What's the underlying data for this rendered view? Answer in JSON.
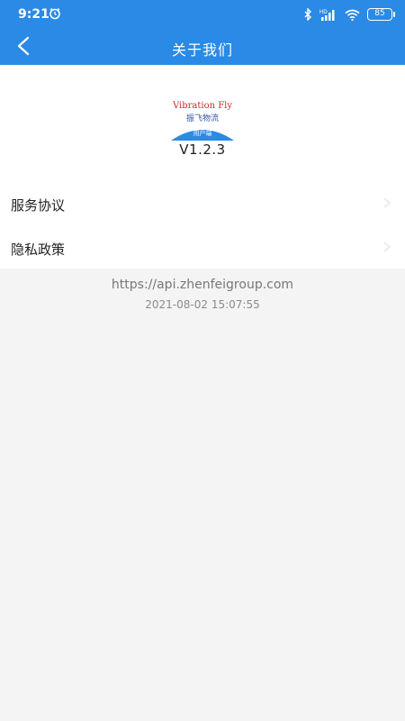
{
  "status_bar": {
    "time": "9:21",
    "battery": "85",
    "network_label": "HD",
    "icons": [
      "alarm-icon",
      "bluetooth-icon",
      "signal-icon",
      "wifi-icon",
      "battery-icon"
    ]
  },
  "app_bar": {
    "title": "关于我们",
    "back_icon": "chevron-left-icon",
    "background": "#2a8ae6"
  },
  "about": {
    "logo_brand": "Vibration Fly",
    "logo_cn": "振飞物流",
    "logo_tag": "用户端",
    "version": "V1.2.3"
  },
  "menu": {
    "items": [
      {
        "label": "服务协议"
      },
      {
        "label": "隐私政策"
      }
    ]
  },
  "footer": {
    "url": "https://api.zhenfeigroup.com",
    "timestamp": "2021-08-02 15:07:55"
  }
}
